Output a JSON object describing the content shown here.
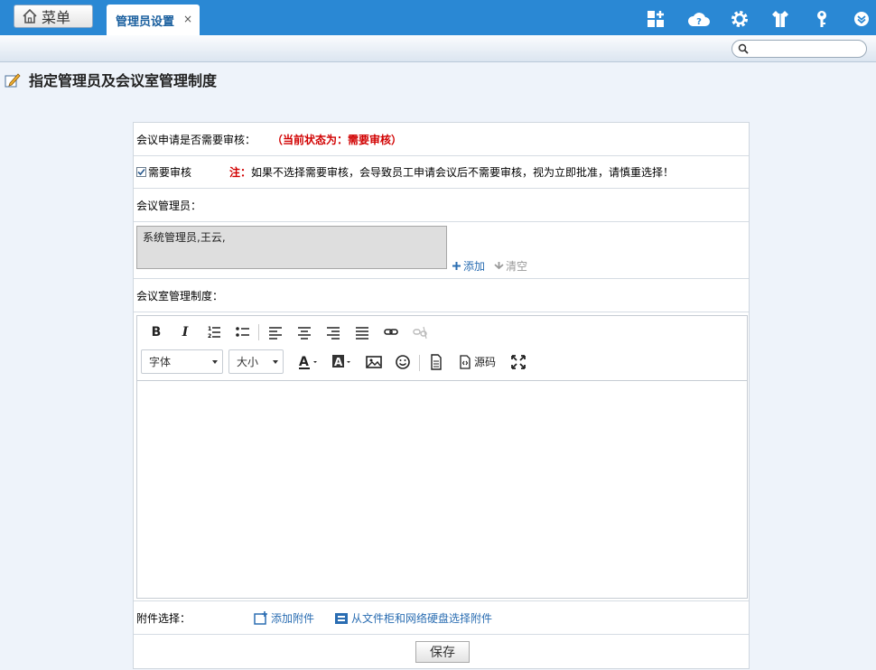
{
  "topbar": {
    "menu_label": "菜单",
    "tab_label": "管理员设置",
    "tab_close": "×",
    "icons": [
      "dashboard-add-icon",
      "help-cloud-icon",
      "settings-gear-icon",
      "shirt-icon",
      "key-icon",
      "collapse-down-icon"
    ]
  },
  "search": {
    "placeholder": ""
  },
  "page": {
    "title": "指定管理员及会议室管理制度"
  },
  "form": {
    "audit_question": "会议申请是否需要审核：",
    "audit_status": "（当前状态为：需要审核）",
    "audit_checkbox_label": "需要审核",
    "note_label": "注：",
    "note_text": "如果不选择需要审核，会导致员工申请会议后不需要审核，视为立即批准，请慎重选择！",
    "admins_label": "会议管理员：",
    "admins_value": "系统管理员,王云,",
    "add_link": "添加",
    "clear_link": "清空",
    "rules_label": "会议室管理制度：",
    "attach_label": "附件选择：",
    "attach_add": "添加附件",
    "attach_from_cabinet": "从文件柜和网络硬盘选择附件",
    "save": "保存"
  },
  "editor": {
    "font_select": "字体",
    "size_select": "大小",
    "source_label": "源码",
    "content": ""
  },
  "colors": {
    "topbar": "#2a88d4",
    "accent_red": "#d10000",
    "link_blue": "#2a6db2"
  }
}
